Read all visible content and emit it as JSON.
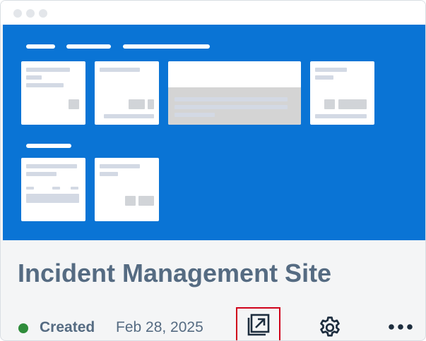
{
  "site_card": {
    "title": "Incident Management Site",
    "status": {
      "label": "Created",
      "color": "#2f8c3b"
    },
    "date": "Feb 28, 2025",
    "actions": [
      {
        "name": "open-site",
        "icon": "open-in-new-window-icon"
      },
      {
        "name": "settings",
        "icon": "gear-icon"
      },
      {
        "name": "more-actions",
        "icon": "more-horizontal-icon"
      }
    ]
  },
  "theme": {
    "preview_background": "#0a74d5",
    "title_color": "#556b82",
    "highlight_border": "#d0021b"
  }
}
